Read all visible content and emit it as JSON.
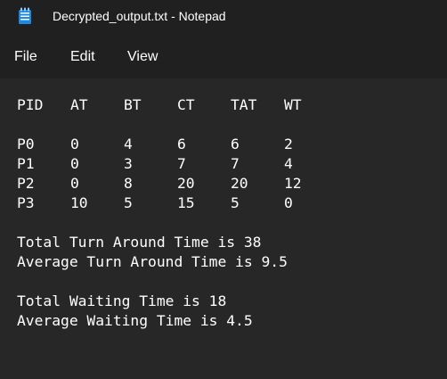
{
  "window": {
    "title": "Decrypted_output.txt - Notepad",
    "app_icon": "notepad-icon"
  },
  "menu": {
    "items": [
      {
        "label": "File"
      },
      {
        "label": "Edit"
      },
      {
        "label": "View"
      }
    ]
  },
  "document": {
    "table": {
      "headers": [
        "PID",
        "AT",
        "BT",
        "CT",
        "TAT",
        "WT"
      ],
      "rows": [
        [
          "P0",
          "0",
          "4",
          "6",
          "6",
          "2"
        ],
        [
          "P1",
          "0",
          "3",
          "7",
          "7",
          "4"
        ],
        [
          "P2",
          "0",
          "8",
          "20",
          "20",
          "12"
        ],
        [
          "P3",
          "10",
          "5",
          "15",
          "5",
          "0"
        ]
      ]
    },
    "total_tat": "Total Turn Around Time is 38",
    "avg_tat": "Average Turn Around Time is 9.5",
    "total_wt": "Total Waiting Time is 18",
    "avg_wt": "Average Waiting Time is 4.5"
  }
}
